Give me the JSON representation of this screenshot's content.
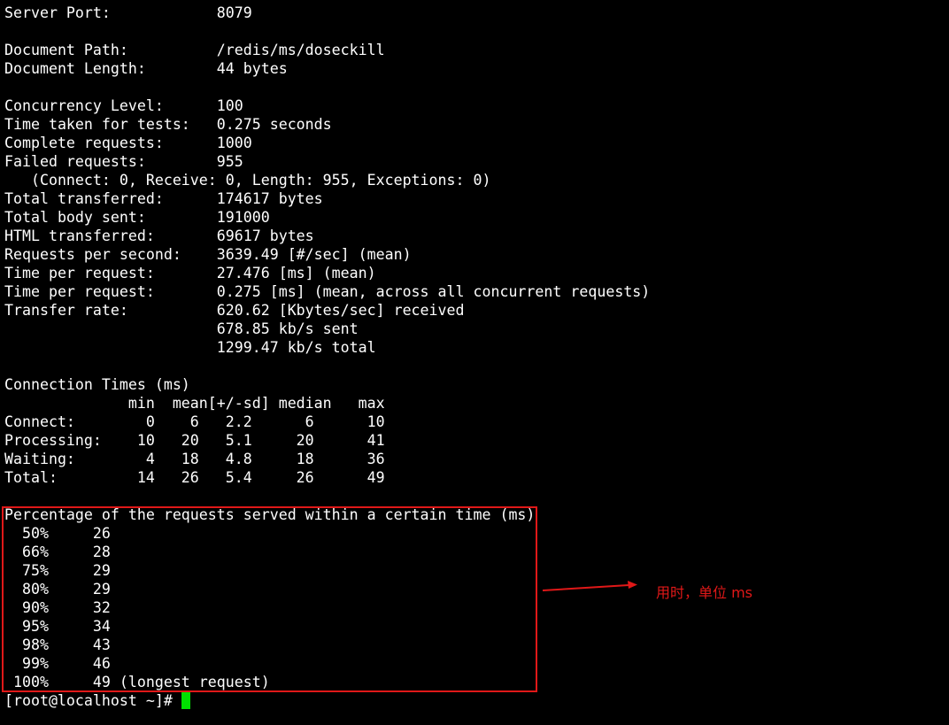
{
  "terminal": {
    "lines": [
      "Server Port:            8079",
      "",
      "Document Path:          /redis/ms/doseckill",
      "Document Length:        44 bytes",
      "",
      "Concurrency Level:      100",
      "Time taken for tests:   0.275 seconds",
      "Complete requests:      1000",
      "Failed requests:        955",
      "   (Connect: 0, Receive: 0, Length: 955, Exceptions: 0)",
      "Total transferred:      174617 bytes",
      "Total body sent:        191000",
      "HTML transferred:       69617 bytes",
      "Requests per second:    3639.49 [#/sec] (mean)",
      "Time per request:       27.476 [ms] (mean)",
      "Time per request:       0.275 [ms] (mean, across all concurrent requests)",
      "Transfer rate:          620.62 [Kbytes/sec] received",
      "                        678.85 kb/s sent",
      "                        1299.47 kb/s total",
      "",
      "Connection Times (ms)",
      "              min  mean[+/-sd] median   max",
      "Connect:        0    6   2.2      6      10",
      "Processing:    10   20   5.1     20      41",
      "Waiting:        4   18   4.8     18      36",
      "Total:         14   26   5.4     26      49",
      "",
      "Percentage of the requests served within a certain time (ms)",
      "  50%     26",
      "  66%     28",
      "  75%     29",
      "  80%     29",
      "  90%     32",
      "  95%     34",
      "  98%     43",
      "  99%     46",
      " 100%     49 (longest request)"
    ],
    "prompt": "[root@localhost ~]# "
  },
  "annotation": {
    "text": "用时，单位 ms",
    "color": "#e01818"
  },
  "colors": {
    "background": "#000000",
    "text": "#ffffff",
    "cursor": "#00e000",
    "highlight": "#e01818"
  }
}
